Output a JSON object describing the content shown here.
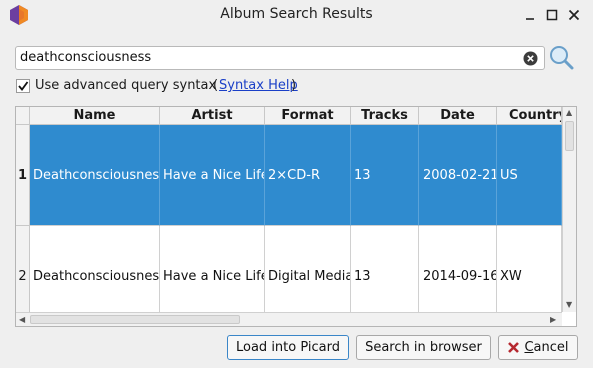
{
  "window": {
    "title": "Album Search Results",
    "accent": "#2f8bcf"
  },
  "search": {
    "value": "deathconsciousness"
  },
  "options": {
    "advanced_label": "Use advanced query syntax",
    "advanced_checked": true,
    "paren_open": "(",
    "syntax_help_link": "Syntax Help",
    "paren_close": ")"
  },
  "table": {
    "columns": [
      "Name",
      "Artist",
      "Format",
      "Tracks",
      "Date",
      "Country"
    ],
    "rows": [
      {
        "num": "1",
        "selected": true,
        "cells": [
          "Deathconsciousness",
          "Have a Nice Life",
          "2×CD-R",
          "13",
          "2008-02-21",
          "US"
        ]
      },
      {
        "num": "2",
        "selected": false,
        "cells": [
          "Deathconsciousness",
          "Have a Nice Life",
          "Digital Media",
          "13",
          "2014-09-16",
          "XW"
        ]
      }
    ]
  },
  "buttons": {
    "load": "Load into Picard",
    "browser": "Search in browser",
    "cancel_prefix": "C",
    "cancel_rest": "ancel"
  },
  "icons": [
    "app-logo-icon",
    "minimize-icon",
    "maximize-icon",
    "close-icon",
    "clear-icon",
    "search-icon",
    "checkmark-icon",
    "cancel-icon"
  ]
}
